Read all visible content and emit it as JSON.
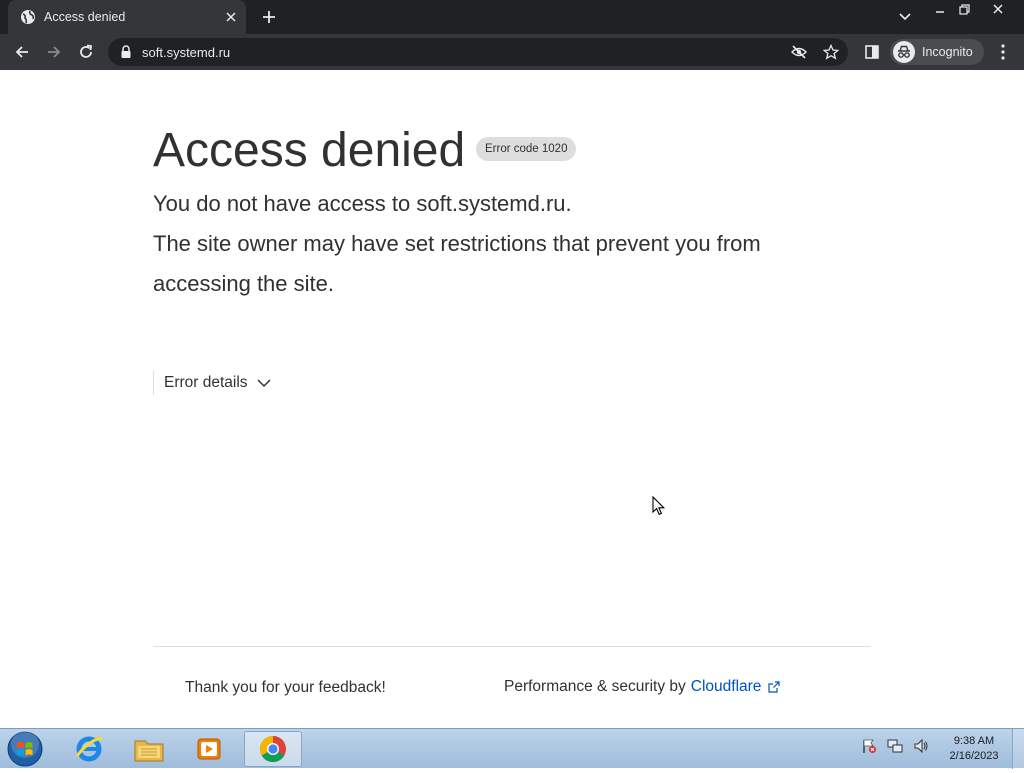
{
  "browser": {
    "tab_title": "Access denied",
    "url": "soft.systemd.ru",
    "incognito_label": "Incognito"
  },
  "page": {
    "heading": "Access denied",
    "error_code": "Error code 1020",
    "lines": [
      "You do not have access to soft.systemd.ru.",
      "The site owner may have set restrictions that prevent you from accessing the site."
    ],
    "details_label": "Error details",
    "feedback_text": "Thank you for your feedback!",
    "perf_prefix": "Performance & security by",
    "cf_link": "Cloudflare"
  },
  "taskbar": {
    "time": "9:38 AM",
    "date": "2/16/2023",
    "apps": [
      "internet-explorer",
      "file-explorer",
      "media-player",
      "chrome"
    ]
  },
  "colors": {
    "text": "#313131",
    "link": "#0051c3",
    "chrome_dark": "#202124",
    "chrome_toolbar": "#35363a"
  }
}
